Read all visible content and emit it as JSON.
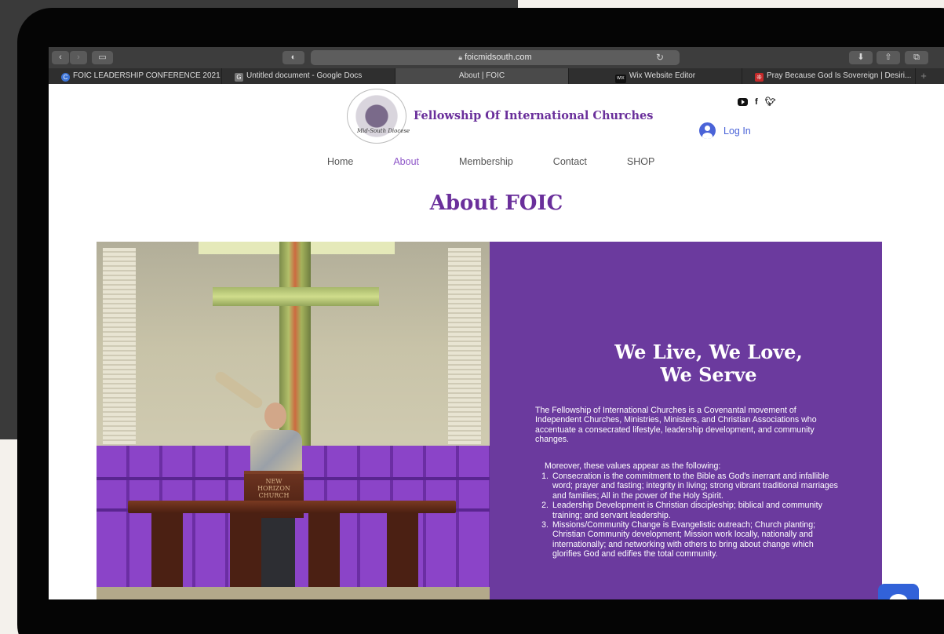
{
  "browser": {
    "url": "foicmidsouth.com",
    "tabs": [
      {
        "label": "FOIC LEADERSHIP CONFERENCE 2021 -...",
        "favicon": "C",
        "color": "#3d74d6"
      },
      {
        "label": "Untitled document - Google Docs",
        "favicon": "G",
        "color": "#777777"
      },
      {
        "label": "About | FOIC",
        "favicon": "",
        "color": ""
      },
      {
        "label": "Wix Website Editor",
        "favicon": "WIX",
        "color": "#111111"
      },
      {
        "label": "Pray Because God Is Sovereign | Desiri...",
        "favicon": "❊",
        "color": "#c52a2a"
      }
    ]
  },
  "site": {
    "title": "Fellowship Of International Churches",
    "logo_script": "Mid-South Diocese",
    "login_label": "Log In",
    "nav": [
      "Home",
      "About",
      "Membership",
      "Contact",
      "SHOP"
    ],
    "active_nav": "About",
    "page_title": "About FOIC",
    "pulpit_text": [
      "NEW",
      "HORIZON",
      "CHURCH"
    ],
    "accent_color": "#6b3a9e"
  },
  "panel": {
    "heading_line1": "We Live, We Love,",
    "heading_line2": "We Serve",
    "intro": "The Fellowship of International Churches is a Covenantal movement of Independent Churches, Ministries, Ministers, and Christian Associations who accentuate a consecrated lifestyle, leadership development, and community changes.",
    "lead": "Moreover, these values appear as the following:",
    "items": [
      {
        "num": "1.",
        "text": "Consecration is the commitment to the Bible as God's inerrant and infallible word; prayer and fasting; integrity in living; strong vibrant traditional marriages and families; All in the power of the Holy Spirit."
      },
      {
        "num": "2.",
        "text": "Leadership Development is Christian discipleship; biblical and community training; and servant leadership."
      },
      {
        "num": "3.",
        "text": "Missions/Community Change is Evangelistic outreach; Church planting; Christian Community development; Mission work locally, nationally and internationally; and networking with others to bring about change which glorifies God and edifies the total community."
      }
    ]
  },
  "icons": [
    "back-icon",
    "forward-icon",
    "sidebar-icon",
    "shield-icon",
    "lock-icon",
    "reload-icon",
    "download-icon",
    "share-icon",
    "tabs-icon",
    "youtube-icon",
    "facebook-icon",
    "twitter-icon",
    "user-icon",
    "chat-icon"
  ]
}
